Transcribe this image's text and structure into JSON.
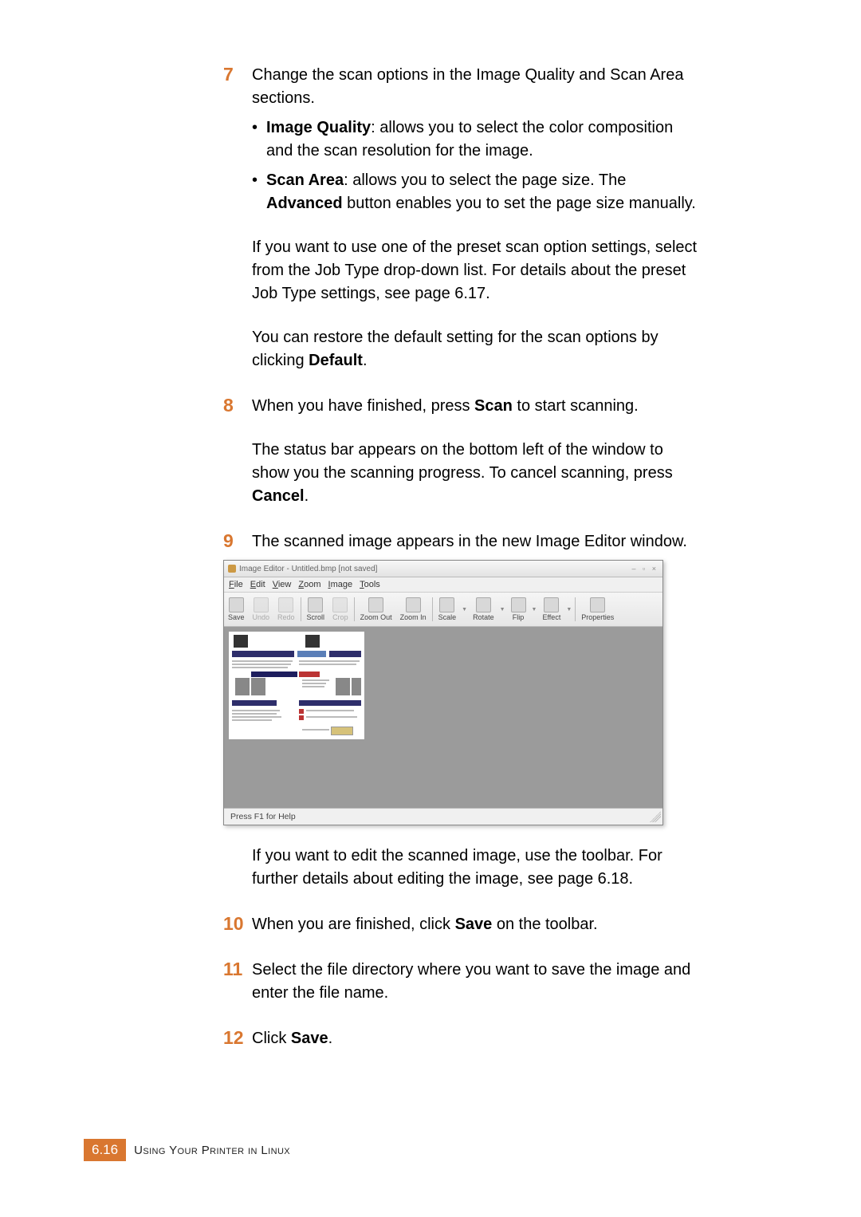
{
  "steps": {
    "s7": {
      "num": "7",
      "intro_a": "Change the scan options in the Image Quality and Scan Area sections.",
      "bullets": [
        {
          "bold": "Image Quality",
          "rest": ": allows you to select the color composition and the scan resolution for the image."
        },
        {
          "bold": "Scan Area",
          "rest_a": ": allows you to select the page size. The ",
          "bold_b": "Advanced",
          "rest_b": " button enables you to set the page size manually."
        }
      ],
      "p2": "If you want to use one of the preset scan option settings, select from the Job Type drop-down list. For details about the preset Job Type settings, see page 6.17.",
      "p3_a": "You can restore the default setting for the scan options by clicking ",
      "p3_bold": "Default",
      "p3_b": "."
    },
    "s8": {
      "num": "8",
      "p1_a": "When you have finished, press ",
      "p1_bold": "Scan",
      "p1_b": " to start scanning.",
      "p2_a": "The status bar appears on the bottom left of the window to show you the scanning progress. To cancel scanning, press ",
      "p2_bold": "Cancel",
      "p2_b": "."
    },
    "s9": {
      "num": "9",
      "p1": "The scanned image appears in the new Image Editor window.",
      "after": "If you want to edit the scanned image, use the toolbar. For further details about editing the image, see page 6.18."
    },
    "s10": {
      "num": "10",
      "p_a": "When you are finished, click ",
      "p_bold": "Save",
      "p_b": " on the toolbar."
    },
    "s11": {
      "num": "11",
      "p": "Select the file directory where you want to save the image and enter the file name."
    },
    "s12": {
      "num": "12",
      "p_a": "Click ",
      "p_bold": "Save",
      "p_b": "."
    }
  },
  "image_editor": {
    "title": "Image Editor - Untitled.bmp [not saved]",
    "menus": {
      "file": "File",
      "edit": "Edit",
      "view": "View",
      "zoom": "Zoom",
      "image": "Image",
      "tools": "Tools"
    },
    "toolbar": {
      "save": "Save",
      "undo": "Undo",
      "redo": "Redo",
      "scroll": "Scroll",
      "crop": "Crop",
      "zoom_out": "Zoom Out",
      "zoom_in": "Zoom In",
      "scale": "Scale",
      "rotate": "Rotate",
      "flip": "Flip",
      "effect": "Effect",
      "properties": "Properties"
    },
    "status": "Press F1 for Help"
  },
  "footer": {
    "page": "6.16",
    "text": "Using Your Printer in Linux"
  }
}
